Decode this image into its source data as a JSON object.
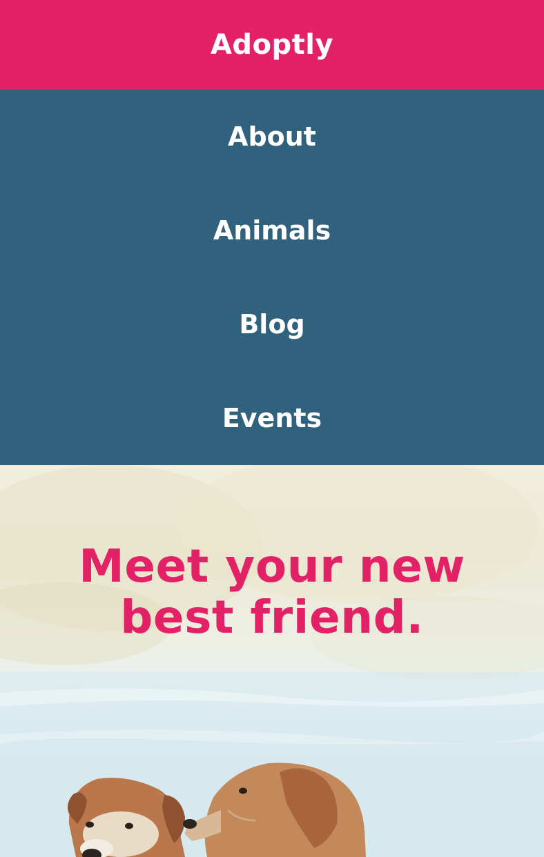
{
  "header": {
    "brand": "Adoptly"
  },
  "nav": {
    "items": [
      {
        "label": "About"
      },
      {
        "label": "Animals"
      },
      {
        "label": "Blog"
      },
      {
        "label": "Events"
      }
    ]
  },
  "hero": {
    "headline_line1": "Meet your new",
    "headline_line2": "best friend.",
    "image_icon": "two-golden-retrievers-photo"
  },
  "colors": {
    "brand_pink": "#e32166",
    "nav_blue": "#30617d",
    "text_white": "#ffffff"
  }
}
